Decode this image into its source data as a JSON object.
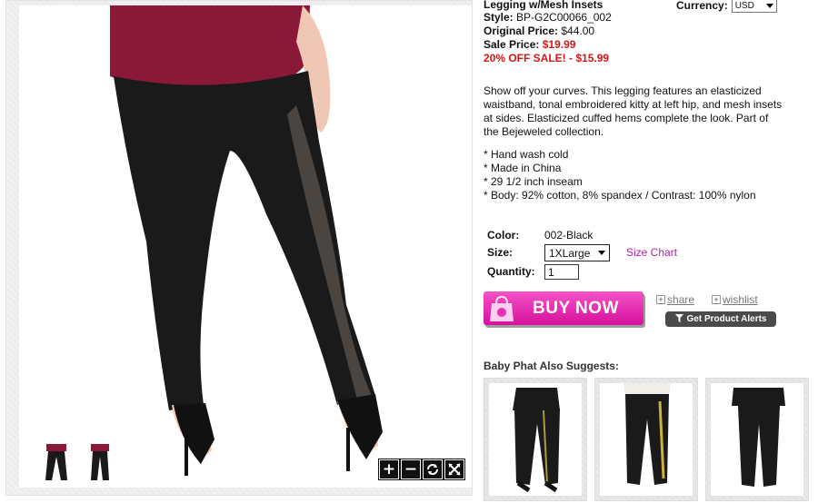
{
  "product": {
    "name": "Legging w/Mesh Insets",
    "style_label": "Style:",
    "style_value": "BP-G2C00066_002",
    "original_label": "Original Price:",
    "original_value": "$44.00",
    "sale_label": "Sale Price:",
    "sale_value": "$19.99",
    "promo": "20% OFF SALE! - $15.99",
    "description": "Show off your curves. This legging features an elasticized waistband, tonal embroidered kitty at left hip, and mesh insets at sides. Elasticized cuffed hems complete the look. Part of the Bejeweled collection.",
    "bullets": [
      "* Hand wash cold",
      "* Made in China",
      "* 29 1/2 inch inseam",
      "* Body: 92% cotton, 8% spandex / Contrast: 100% nylon"
    ]
  },
  "currency": {
    "label": "Currency:",
    "selected": "USD"
  },
  "options": {
    "color_label": "Color:",
    "color_value": "002-Black",
    "size_label": "Size:",
    "size_value": "1XLarge",
    "size_chart_link": "Size Chart",
    "quantity_label": "Quantity:",
    "quantity_value": "1"
  },
  "actions": {
    "buy_now": "BUY NOW",
    "share": "share",
    "wishlist": "wishlist",
    "product_alerts": "Get Product Alerts"
  },
  "suggestions": {
    "title": "Baby Phat Also Suggests:"
  },
  "zoom_controls": {
    "zoom_in": "+",
    "zoom_out": "−"
  },
  "colors": {
    "sale_red": "#d01818",
    "buy_pink": "#e52fb4",
    "link_magenta": "#b51ca9"
  }
}
